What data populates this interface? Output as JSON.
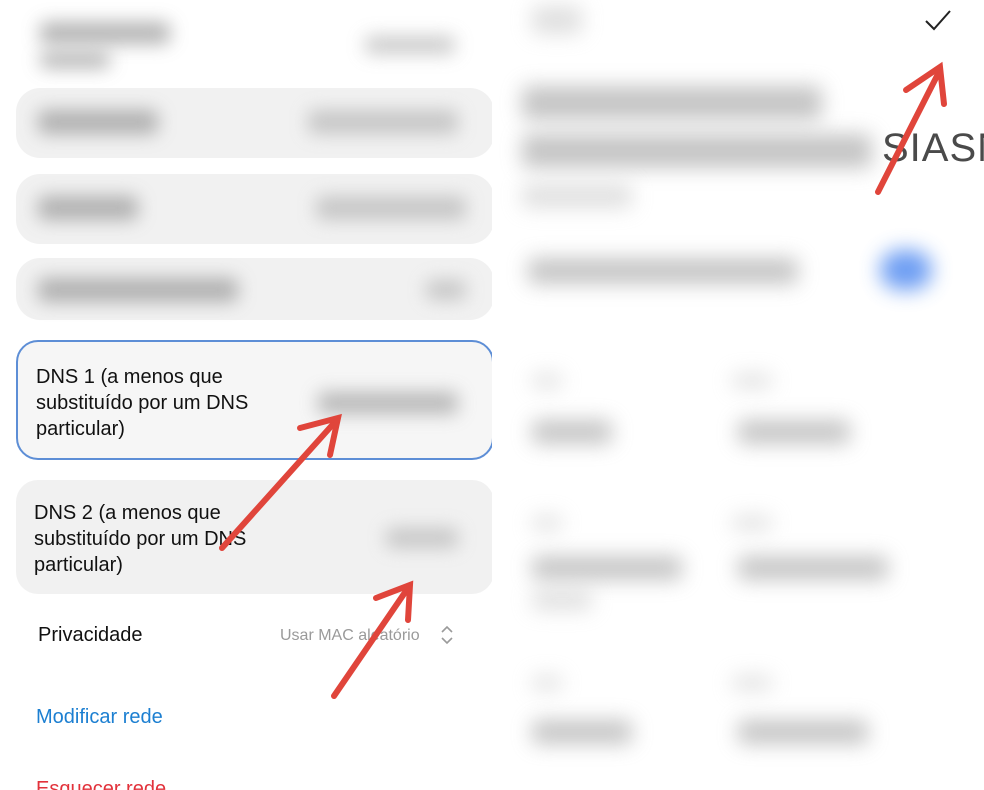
{
  "left": {
    "dns1": {
      "label": "DNS 1 (a menos que substituído por um DNS particular)"
    },
    "dns2": {
      "label": "DNS 2 (a menos que substituído por um DNS particular)"
    },
    "privacy": {
      "label": "Privacidade",
      "value": "Usar MAC aleatório",
      "icon": "sort-icon"
    },
    "modify_link": "Modificar rede",
    "forget_link": "Esquecer rede"
  },
  "right": {
    "ssid_partial": "SIASN",
    "confirm_icon": "check-icon"
  },
  "colors": {
    "focus_border": "#5d8ed6",
    "link_blue": "#1c7fd1",
    "link_red": "#e2323b",
    "arrow_red": "#e0453b",
    "toggle_blue": "#4a86f0"
  }
}
